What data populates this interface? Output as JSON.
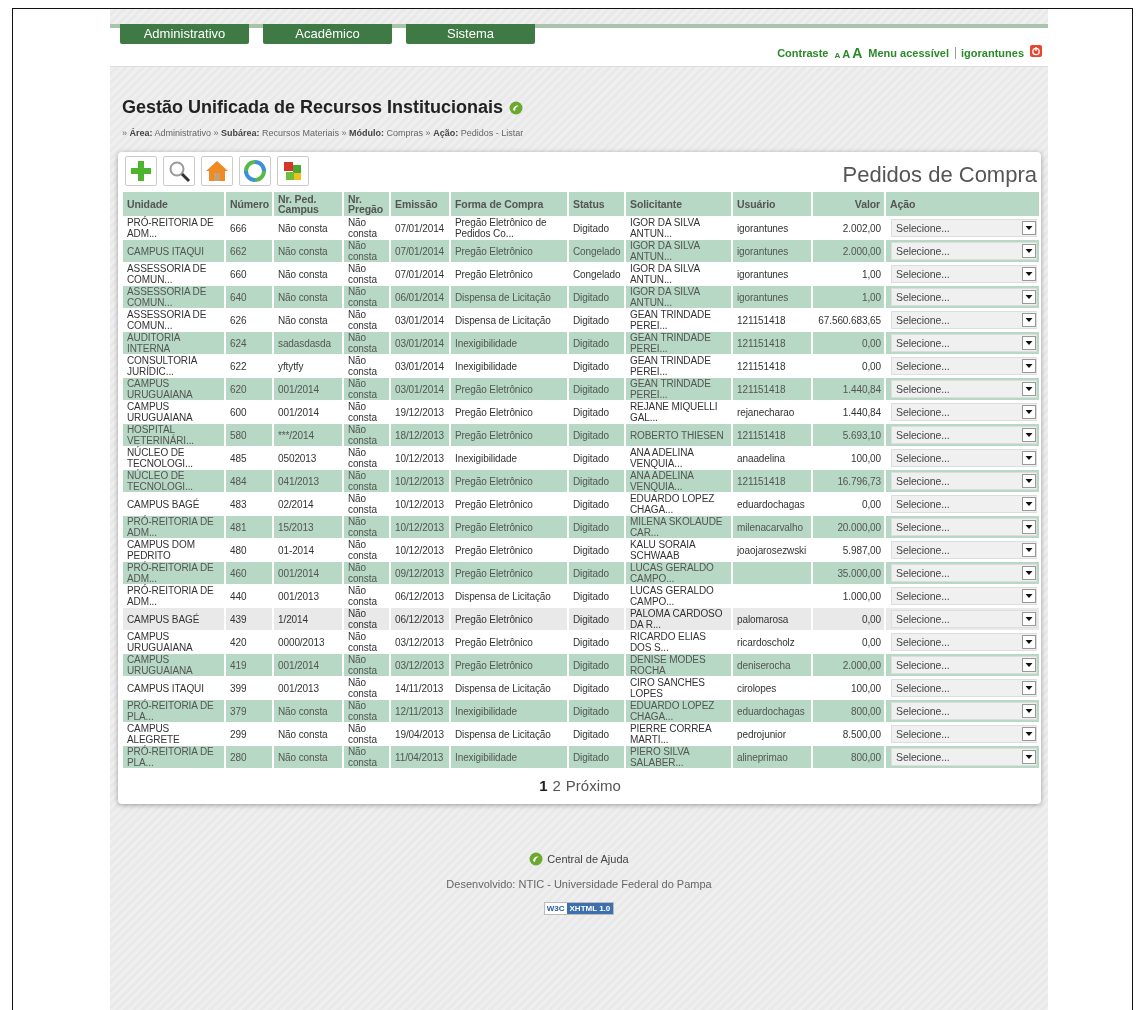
{
  "nav_tabs": [
    "Administrativo",
    "Acadêmico",
    "Sistema"
  ],
  "top_links": {
    "contrast": "Contraste",
    "font_sizes": [
      "A",
      "A",
      "A"
    ],
    "accessible_menu": "Menu acessível",
    "user": "igorantunes"
  },
  "app_title": "Gestão Unificada de Recursos Institucionais",
  "breadcrumb": "» **Área:** Administrativo » **Subárea:** Recursos Materiais » **Módulo:** Compras » **Ação:** Pedidos - Listar",
  "toolbar": [
    {
      "kind": "add"
    },
    {
      "kind": "search"
    },
    {
      "kind": "home"
    },
    {
      "kind": "refresh"
    },
    {
      "kind": "puzzle"
    }
  ],
  "page_title": "Pedidos de Compra",
  "table": {
    "columns": [
      "Unidade",
      "Número",
      "Nr. Ped. Campus",
      "Nr. Pregão",
      "Emissão",
      "Forma de Compra",
      "Status",
      "Solicitante",
      "Usuário",
      "Valor",
      "Ação"
    ],
    "rows": [
      {
        "unidade": "PRÓ-REITORIA DE ADM...",
        "numero": "666",
        "campus": "Não consta",
        "pregao": "Não consta",
        "emissao": "07/01/2014",
        "forma": "Pregão Eletrônico de Pedidos Co...",
        "status": "Digitado",
        "solicitante": "IGOR DA SILVA ANTUN...",
        "usuario": "igorantunes",
        "valor": "2.002,00",
        "acao": "Selecione...",
        "selected": false
      },
      {
        "unidade": "CAMPUS ITAQUI",
        "numero": "662",
        "campus": "Não consta",
        "pregao": "Não consta",
        "emissao": "07/01/2014",
        "forma": "Pregão Eletrônico",
        "status": "Congelado",
        "solicitante": "IGOR DA SILVA ANTUN...",
        "usuario": "igorantunes",
        "valor": "2.000,00",
        "acao": "Selecione...",
        "selected": false
      },
      {
        "unidade": "ASSESSORIA DE COMUN...",
        "numero": "660",
        "campus": "Não consta",
        "pregao": "Não consta",
        "emissao": "07/01/2014",
        "forma": "Pregão Eletrônico",
        "status": "Congelado",
        "solicitante": "IGOR DA SILVA ANTUN...",
        "usuario": "igorantunes",
        "valor": "1,00",
        "acao": "Selecione...",
        "selected": false
      },
      {
        "unidade": "ASSESSORIA DE COMUN...",
        "numero": "640",
        "campus": "Não consta",
        "pregao": "Não consta",
        "emissao": "06/01/2014",
        "forma": "Dispensa de Licitação",
        "status": "Digitado",
        "solicitante": "IGOR DA SILVA ANTUN...",
        "usuario": "igorantunes",
        "valor": "1,00",
        "acao": "Selecione...",
        "selected": false
      },
      {
        "unidade": "ASSESSORIA DE COMUN...",
        "numero": "626",
        "campus": "Não consta",
        "pregao": "Não consta",
        "emissao": "03/01/2014",
        "forma": "Dispensa de Licitação",
        "status": "Digitado",
        "solicitante": "GEAN TRINDADE PEREI...",
        "usuario": "121151418",
        "valor": "67.560.683,65",
        "acao": "Selecione...",
        "selected": false
      },
      {
        "unidade": "AUDITORIA INTERNA",
        "numero": "624",
        "campus": "sadasdasda",
        "pregao": "Não consta",
        "emissao": "03/01/2014",
        "forma": "Inexigibilidade",
        "status": "Digitado",
        "solicitante": "GEAN TRINDADE PEREI...",
        "usuario": "121151418",
        "valor": "0,00",
        "acao": "Selecione...",
        "selected": false
      },
      {
        "unidade": "CONSULTORIA JURÍDIC...",
        "numero": "622",
        "campus": "yftytfy",
        "pregao": "Não consta",
        "emissao": "03/01/2014",
        "forma": "Inexigibilidade",
        "status": "Digitado",
        "solicitante": "GEAN TRINDADE PEREI...",
        "usuario": "121151418",
        "valor": "0,00",
        "acao": "Selecione...",
        "selected": false
      },
      {
        "unidade": "CAMPUS URUGUAIANA",
        "numero": "620",
        "campus": "001/2014",
        "pregao": "Não consta",
        "emissao": "03/01/2014",
        "forma": "Pregão Eletrônico",
        "status": "Digitado",
        "solicitante": "GEAN TRINDADE PEREI...",
        "usuario": "121151418",
        "valor": "1.440,84",
        "acao": "Selecione...",
        "selected": false
      },
      {
        "unidade": "CAMPUS URUGUAIANA",
        "numero": "600",
        "campus": "001/2014",
        "pregao": "Não consta",
        "emissao": "19/12/2013",
        "forma": "Pregão Eletrônico",
        "status": "Digitado",
        "solicitante": "REJANE MIQUELLI GAL...",
        "usuario": "rejanecharao",
        "valor": "1.440,84",
        "acao": "Selecione...",
        "selected": false
      },
      {
        "unidade": "HOSPITAL VETERINÁRI...",
        "numero": "580",
        "campus": "***/2014",
        "pregao": "Não consta",
        "emissao": "18/12/2013",
        "forma": "Pregão Eletrônico",
        "status": "Digitado",
        "solicitante": "ROBERTO THIESEN",
        "usuario": "121151418",
        "valor": "5.693,10",
        "acao": "Selecione...",
        "selected": false
      },
      {
        "unidade": "NÚCLEO DE TECNOLOGI...",
        "numero": "485",
        "campus": "0502013",
        "pregao": "Não consta",
        "emissao": "10/12/2013",
        "forma": "Inexigibilidade",
        "status": "Digitado",
        "solicitante": "ANA ADELINA VENQUIA...",
        "usuario": "anaadelina",
        "valor": "100,00",
        "acao": "Selecione...",
        "selected": false
      },
      {
        "unidade": "NÚCLEO DE TECNOLOGI...",
        "numero": "484",
        "campus": "041/2013",
        "pregao": "Não consta",
        "emissao": "10/12/2013",
        "forma": "Pregão Eletrônico",
        "status": "Digitado",
        "solicitante": "ANA ADELINA VENQUIA...",
        "usuario": "121151418",
        "valor": "16.796,73",
        "acao": "Selecione...",
        "selected": false
      },
      {
        "unidade": "CAMPUS BAGÉ",
        "numero": "483",
        "campus": "02/2014",
        "pregao": "Não consta",
        "emissao": "10/12/2013",
        "forma": "Pregão Eletrônico",
        "status": "Digitado",
        "solicitante": "EDUARDO LOPEZ CHAGA...",
        "usuario": "eduardochagas",
        "valor": "0,00",
        "acao": "Selecione...",
        "selected": false
      },
      {
        "unidade": "PRÓ-REITORIA DE ADM...",
        "numero": "481",
        "campus": "15/2013",
        "pregao": "Não consta",
        "emissao": "10/12/2013",
        "forma": "Pregão Eletrônico",
        "status": "Digitado",
        "solicitante": "MILENA SKOLAUDE CAR...",
        "usuario": "milenacarvalho",
        "valor": "20.000,00",
        "acao": "Selecione...",
        "selected": false
      },
      {
        "unidade": "CAMPUS DOM PEDRITO",
        "numero": "480",
        "campus": "01-2014",
        "pregao": "Não consta",
        "emissao": "10/12/2013",
        "forma": "Pregão Eletrônico",
        "status": "Digitado",
        "solicitante": "KALU SORAIA SCHWAAB",
        "usuario": "joaojarosezwski",
        "valor": "5.987,00",
        "acao": "Selecione...",
        "selected": false
      },
      {
        "unidade": "PRÓ-REITORIA DE ADM...",
        "numero": "460",
        "campus": "001/2014",
        "pregao": "Não consta",
        "emissao": "09/12/2013",
        "forma": "Pregão Eletrônico",
        "status": "Digitado",
        "solicitante": "LUCAS GERALDO CAMPO...",
        "valor": "35.000,00",
        "acao": "Selecione...",
        "selected": false
      },
      {
        "unidade": "PRÓ-REITORIA DE ADM...",
        "numero": "440",
        "campus": "001/2013",
        "pregao": "Não consta",
        "emissao": "06/12/2013",
        "forma": "Dispensa de Licitação",
        "status": "Digitado",
        "solicitante": "LUCAS GERALDO CAMPO...",
        "valor": "1.000,00",
        "acao": "Selecione...",
        "selected": false
      },
      {
        "unidade": "CAMPUS BAGÉ",
        "numero": "439",
        "campus": "1/2014",
        "pregao": "Não consta",
        "emissao": "06/12/2013",
        "forma": "Pregão Eletrônico",
        "status": "Digitado",
        "solicitante": "PALOMA CARDOSO DA R...",
        "usuario": "palomarosa",
        "valor": "0,00",
        "acao": "Selecione...",
        "selected": true
      },
      {
        "unidade": "CAMPUS URUGUAIANA",
        "numero": "420",
        "campus": "0000/2013",
        "pregao": "Não consta",
        "emissao": "03/12/2013",
        "forma": "Pregão Eletrônico",
        "status": "Digitado",
        "solicitante": "RICARDO ELIAS DOS S...",
        "usuario": "ricardoscholz",
        "valor": "0,00",
        "acao": "Selecione...",
        "selected": false
      },
      {
        "unidade": "CAMPUS URUGUAIANA",
        "numero": "419",
        "campus": "001/2014",
        "pregao": "Não consta",
        "emissao": "03/12/2013",
        "forma": "Pregão Eletrônico",
        "status": "Digitado",
        "solicitante": "DENISE MODES ROCHA",
        "usuario": "deniserocha",
        "valor": "2.000,00",
        "acao": "Selecione...",
        "selected": false
      },
      {
        "unidade": "CAMPUS ITAQUI",
        "numero": "399",
        "campus": "001/2013",
        "pregao": "Não consta",
        "emissao": "14/11/2013",
        "forma": "Dispensa de Licitação",
        "status": "Digitado",
        "solicitante": "CIRO SANCHES LOPES",
        "usuario": "cirolopes",
        "valor": "100,00",
        "acao": "Selecione...",
        "selected": false
      },
      {
        "unidade": "PRÓ-REITORIA DE PLA...",
        "numero": "379",
        "campus": "Não consta",
        "pregao": "Não consta",
        "emissao": "12/11/2013",
        "forma": "Inexigibilidade",
        "status": "Digitado",
        "solicitante": "EDUARDO LOPEZ CHAGA...",
        "usuario": "eduardochagas",
        "valor": "800,00",
        "acao": "Selecione...",
        "selected": false
      },
      {
        "unidade": "CAMPUS ALEGRETE",
        "numero": "299",
        "campus": "Não consta",
        "pregao": "Não consta",
        "emissao": "19/04/2013",
        "forma": "Dispensa de Licitação",
        "status": "Digitado",
        "solicitante": "PIERRE CORREA MARTI...",
        "usuario": "pedrojunior",
        "valor": "8.500,00",
        "acao": "Selecione...",
        "selected": false
      },
      {
        "unidade": "PRÓ-REITORIA DE PLA...",
        "numero": "280",
        "campus": "Não consta",
        "pregao": "Não consta",
        "emissao": "11/04/2013",
        "forma": "Inexigibilidade",
        "status": "Digitado",
        "solicitante": "PIERO SILVA SALABER...",
        "usuario": "alineprimao",
        "valor": "800,00",
        "acao": "Selecione...",
        "selected": false
      }
    ]
  },
  "pagination": {
    "pages": [
      {
        "label": "1",
        "selected": true
      },
      {
        "label": "2",
        "selected": false
      }
    ],
    "next": "Próximo"
  },
  "footer": {
    "help": "Central de Ajuda",
    "credits": "Desenvolvido: NTIC - Universidade Federal do Pampa",
    "badge": {
      "left": "W3C",
      "right": "XHTML 1.0"
    }
  }
}
